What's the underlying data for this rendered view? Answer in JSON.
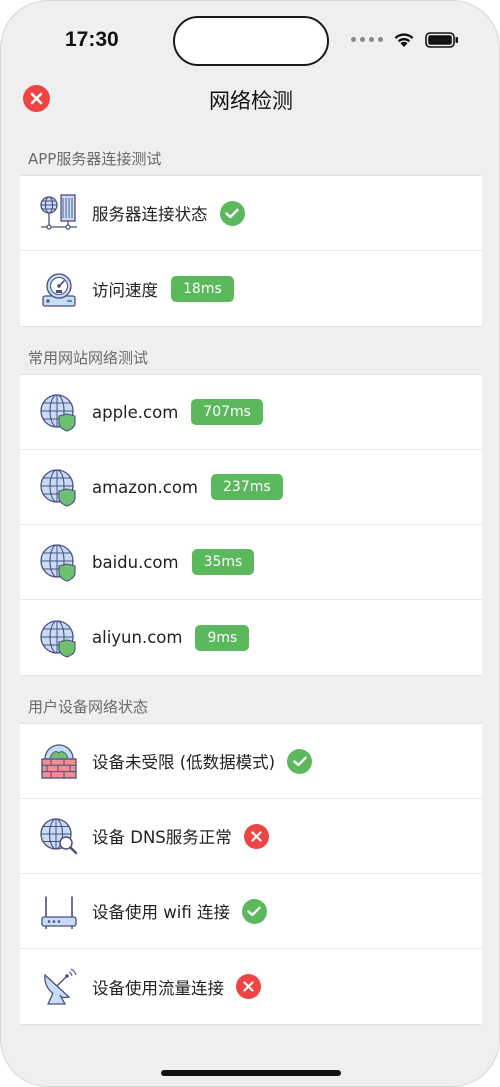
{
  "status_bar": {
    "time": "17:30"
  },
  "nav": {
    "title": "网络检测"
  },
  "sections": [
    {
      "header": "APP服务器连接测试",
      "rows": [
        {
          "label": "服务器连接状态",
          "status": "ok",
          "icon": "server-icon"
        },
        {
          "label": "访问速度",
          "badge": "18ms",
          "icon": "speedometer-icon"
        }
      ]
    },
    {
      "header": "常用网站网络测试",
      "rows": [
        {
          "label": "apple.com",
          "badge": "707ms",
          "icon": "globe-shield-icon"
        },
        {
          "label": "amazon.com",
          "badge": "237ms",
          "icon": "globe-shield-icon"
        },
        {
          "label": "baidu.com",
          "badge": "35ms",
          "icon": "globe-shield-icon"
        },
        {
          "label": "aliyun.com",
          "badge": "9ms",
          "icon": "globe-shield-icon"
        }
      ]
    },
    {
      "header": "用户设备网络状态",
      "rows": [
        {
          "label": "设备未受限 (低数据模式)",
          "status": "ok",
          "icon": "firewall-icon"
        },
        {
          "label": "设备 DNS服务正常",
          "status": "error",
          "icon": "globe-search-icon"
        },
        {
          "label": "设备使用 wifi 连接",
          "status": "ok",
          "icon": "router-icon"
        },
        {
          "label": "设备使用流量连接",
          "status": "error",
          "icon": "satellite-dish-icon"
        }
      ]
    }
  ],
  "colors": {
    "ok": "#5cb85c",
    "error": "#ee4444",
    "background": "#efefef"
  }
}
